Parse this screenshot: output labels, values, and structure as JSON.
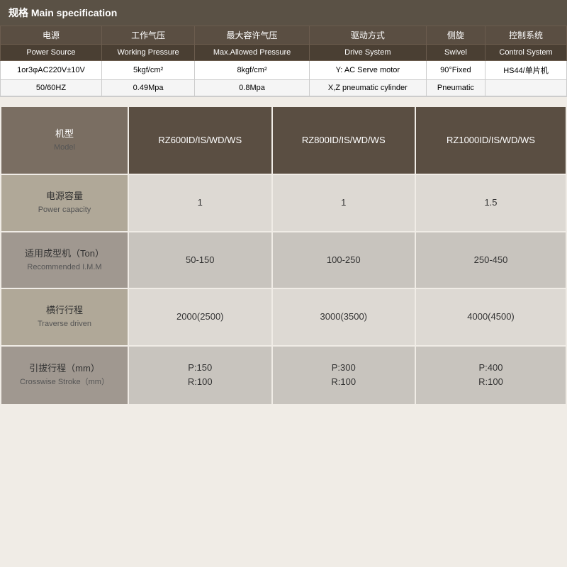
{
  "header": {
    "title": "规格 Main specification"
  },
  "spec_table": {
    "chinese_headers": [
      "电源",
      "工作气压",
      "最大容许气压",
      "驱动方式",
      "侧旋",
      "控制系统"
    ],
    "english_headers": [
      "Power Source",
      "Working Pressure",
      "Max.Allowed Pressure",
      "Drive System",
      "Swivel",
      "Control System"
    ],
    "rows": [
      [
        "1or3φAC220V±10V",
        "5kgf/cm²",
        "8kgf/cm²",
        "Y: AC Serve motor",
        "90°Fixed",
        "HS44/单片机"
      ],
      [
        "50/60HZ",
        "0.49Mpa",
        "0.8Mpa",
        "X,Z pneumatic cylinder",
        "Pneumatic",
        ""
      ]
    ]
  },
  "model_table": {
    "label_col": {
      "header_chinese": "机型",
      "header_english": "Model"
    },
    "models": [
      "RZ600ID/IS/WD/WS",
      "RZ800ID/IS/WD/WS",
      "RZ1000ID/IS/WD/WS"
    ],
    "rows": [
      {
        "label_chinese": "电源容量",
        "label_english": "Power capacity",
        "values": [
          "1",
          "1",
          "1.5"
        ]
      },
      {
        "label_chinese": "适用成型机（Ton）",
        "label_english": "Recommended I.M.M",
        "values": [
          "50-150",
          "100-250",
          "250-450"
        ]
      },
      {
        "label_chinese": "横行行程",
        "label_english": "Traverse driven",
        "values": [
          "2000(2500)",
          "3000(3500)",
          "4000(4500)"
        ]
      },
      {
        "label_chinese": "引拔行程（mm）",
        "label_english": "Crosswise Stroke（mm）",
        "values": [
          "P:150\nR:100",
          "P:300\nR:100",
          "P:400\nR:100"
        ]
      }
    ]
  }
}
